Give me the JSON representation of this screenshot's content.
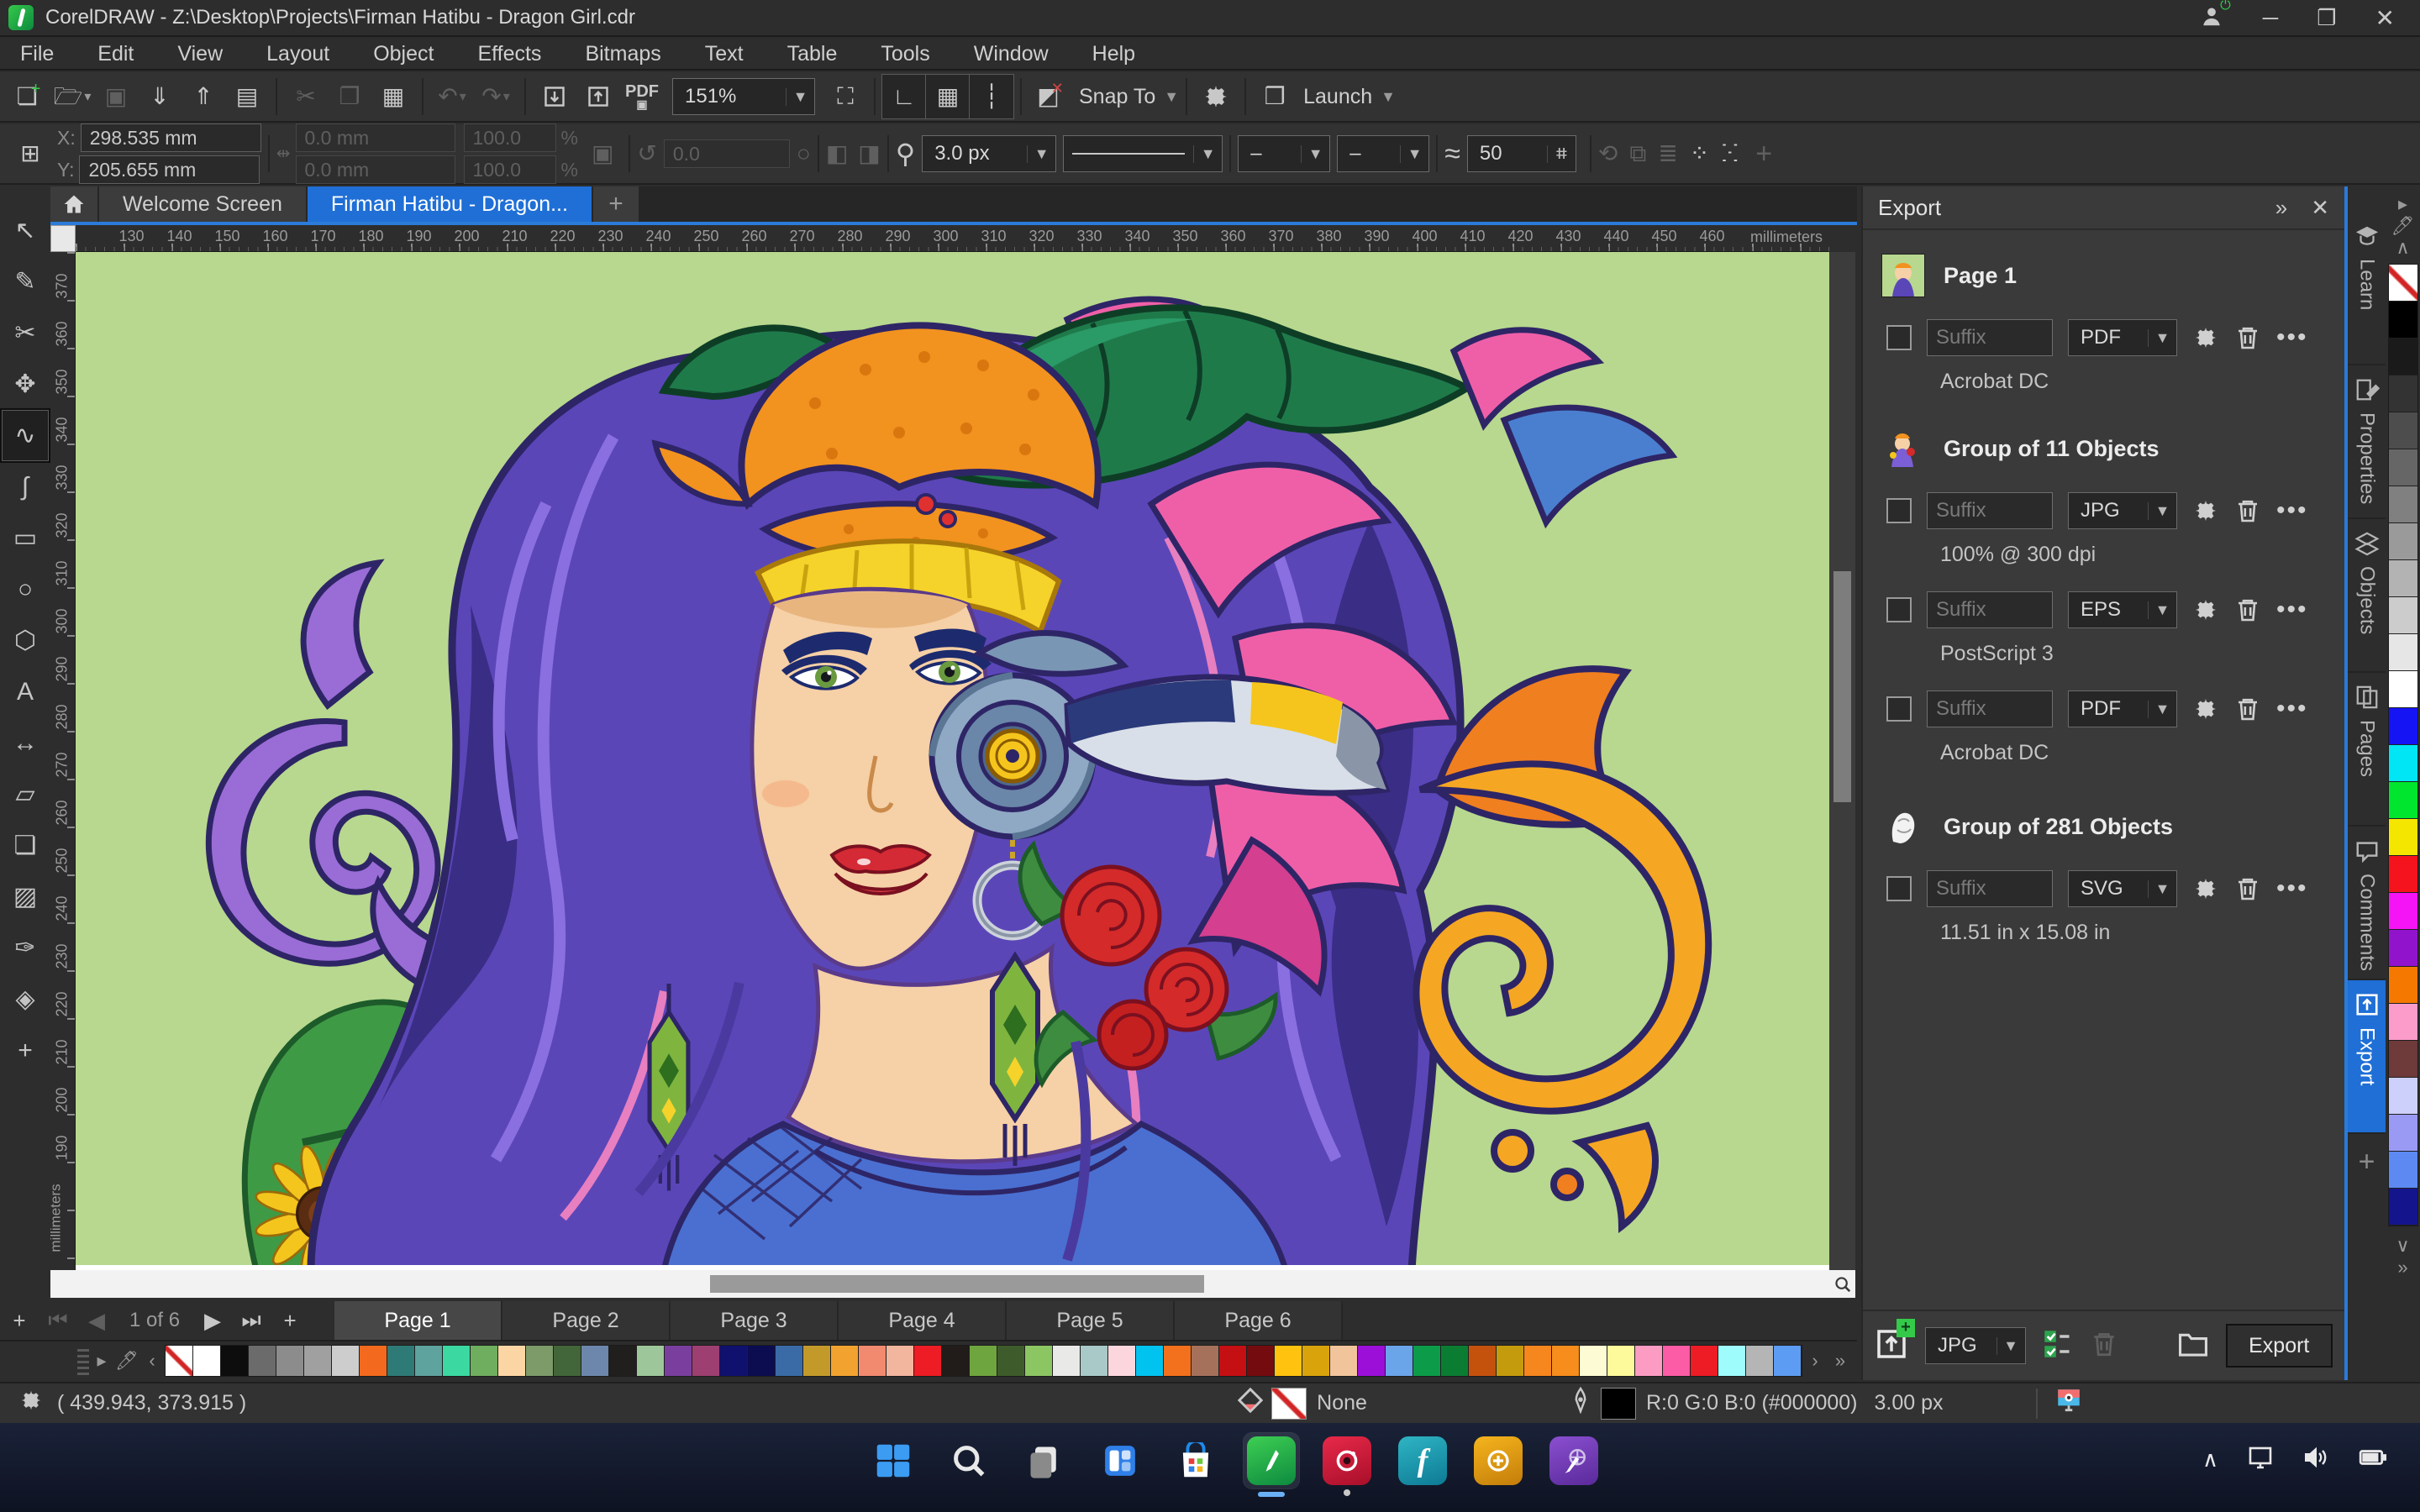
{
  "window": {
    "title": "CorelDRAW - Z:\\Desktop\\Projects\\Firman Hatibu - Dragon Girl.cdr"
  },
  "menu": {
    "items": [
      "File",
      "Edit",
      "View",
      "Layout",
      "Object",
      "Effects",
      "Bitmaps",
      "Text",
      "Table",
      "Tools",
      "Window",
      "Help"
    ]
  },
  "standard_toolbar": {
    "zoom_level": "151%",
    "pdf_label": "PDF",
    "snap_label": "Snap To",
    "launch_label": "Launch"
  },
  "property_bar": {
    "x_label": "X:",
    "x_value": "298.535 mm",
    "y_label": "Y:",
    "y_value": "205.655 mm",
    "width_value": "0.0 mm",
    "height_value": "0.0 mm",
    "scale_x": "100.0",
    "scale_y": "100.0",
    "percent": "%",
    "rotation": "0.0",
    "outline_width": "3.0 px",
    "smoothing": "50"
  },
  "doc_tabs": {
    "tabs": [
      {
        "label": "Welcome Screen",
        "active": false
      },
      {
        "label": "Firman Hatibu - Dragon...",
        "active": true
      }
    ]
  },
  "ruler": {
    "h_numbers": [
      "130",
      "140",
      "150",
      "160",
      "170",
      "180",
      "190",
      "200",
      "210",
      "220",
      "230",
      "240",
      "250",
      "260",
      "270",
      "280",
      "290",
      "300",
      "310",
      "320",
      "330",
      "340",
      "350",
      "360",
      "370",
      "380",
      "390",
      "400",
      "410",
      "420",
      "430",
      "440",
      "450",
      "460"
    ],
    "v_numbers": [
      "370",
      "360",
      "350",
      "340",
      "330",
      "320",
      "310",
      "300",
      "290",
      "280",
      "270",
      "260",
      "250",
      "240",
      "230",
      "220",
      "210",
      "200",
      "190"
    ],
    "units": "millimeters"
  },
  "toolbox": {
    "tools": [
      {
        "name": "pick-tool",
        "glyph": "↖",
        "selected": false
      },
      {
        "name": "shape-tool",
        "glyph": "✎",
        "selected": false
      },
      {
        "name": "crop-tool",
        "glyph": "✂",
        "selected": false
      },
      {
        "name": "pan-tool",
        "glyph": "✥",
        "selected": false
      },
      {
        "name": "freehand-tool",
        "glyph": "∿",
        "selected": true
      },
      {
        "name": "artistic-media-tool",
        "glyph": "∫",
        "selected": false
      },
      {
        "name": "rectangle-tool",
        "glyph": "▭",
        "selected": false
      },
      {
        "name": "ellipse-tool",
        "glyph": "○",
        "selected": false
      },
      {
        "name": "polygon-tool",
        "glyph": "⬡",
        "selected": false
      },
      {
        "name": "text-tool",
        "glyph": "A",
        "selected": false
      },
      {
        "name": "dimension-tool",
        "glyph": "↔",
        "selected": false
      },
      {
        "name": "connector-tool",
        "glyph": "▱",
        "selected": false
      },
      {
        "name": "drop-shadow-tool",
        "glyph": "❏",
        "selected": false
      },
      {
        "name": "transparency-tool",
        "glyph": "▨",
        "selected": false
      },
      {
        "name": "color-eyedropper-tool",
        "glyph": "✑",
        "selected": false
      },
      {
        "name": "interactive-fill-tool",
        "glyph": "◈",
        "selected": false
      },
      {
        "name": "add-tool-button",
        "glyph": "+",
        "selected": false
      }
    ]
  },
  "export_panel": {
    "title": "Export",
    "items": [
      {
        "title": "Page 1",
        "rows": [
          {
            "suffix_placeholder": "Suffix",
            "format": "PDF",
            "note": "Acrobat DC"
          }
        ]
      },
      {
        "title": "Group of 11 Objects",
        "rows": [
          {
            "suffix_placeholder": "Suffix",
            "format": "JPG",
            "note": "100% @ 300 dpi"
          },
          {
            "suffix_placeholder": "Suffix",
            "format": "EPS",
            "note": "PostScript 3"
          },
          {
            "suffix_placeholder": "Suffix",
            "format": "PDF",
            "note": "Acrobat DC"
          }
        ]
      },
      {
        "title": "Group of 281 Objects",
        "rows": [
          {
            "suffix_placeholder": "Suffix",
            "format": "SVG",
            "note": "11.51 in x 15.08 in"
          }
        ]
      }
    ],
    "footer": {
      "format": "JPG",
      "export_label": "Export"
    }
  },
  "dock": {
    "tabs": [
      {
        "label": "Learn",
        "active": false
      },
      {
        "label": "Properties",
        "active": false
      },
      {
        "label": "Objects",
        "active": false
      },
      {
        "label": "Pages",
        "active": false
      },
      {
        "label": "Comments",
        "active": false
      },
      {
        "label": "Export",
        "active": true
      }
    ]
  },
  "page_nav": {
    "counter": "1 of 6",
    "pages": [
      {
        "label": "Page 1",
        "active": true
      },
      {
        "label": "Page 2",
        "active": false
      },
      {
        "label": "Page 3",
        "active": false
      },
      {
        "label": "Page 4",
        "active": false
      },
      {
        "label": "Page 5",
        "active": false
      },
      {
        "label": "Page 6",
        "active": false
      }
    ]
  },
  "palette_bottom": {
    "swatches": [
      {
        "name": "none",
        "css": "linear-gradient(45deg,#fff 42%,#d22525 46%,#d22525 54%,#fff 58%)"
      },
      {
        "name": "white",
        "css": "#ffffff"
      },
      {
        "name": "black",
        "css": "#0d0d0d"
      },
      {
        "name": "gray-60",
        "css": "#6b6b6b"
      },
      {
        "name": "gray-50",
        "css": "#8c8c8c"
      },
      {
        "name": "gray-40",
        "css": "#a0a0a0"
      },
      {
        "name": "gray-20",
        "css": "#cdcdcd"
      },
      {
        "name": "orange",
        "css": "#f3691d"
      },
      {
        "name": "dark-teal",
        "css": "#2e7a76"
      },
      {
        "name": "teal",
        "css": "#5ea39e"
      },
      {
        "name": "spring-green",
        "css": "#3bd9a1"
      },
      {
        "name": "green",
        "css": "#6fae5f"
      },
      {
        "name": "peach",
        "css": "#fbd6a4"
      },
      {
        "name": "sage",
        "css": "#7d9a69"
      },
      {
        "name": "forest",
        "css": "#43653a"
      },
      {
        "name": "blue-gray",
        "css": "#6d87ac"
      },
      {
        "name": "near-black",
        "css": "#201f1d"
      },
      {
        "name": "pale-green",
        "css": "#9dc79a"
      },
      {
        "name": "purple",
        "css": "#7a3f9e"
      },
      {
        "name": "plum",
        "css": "#9d3f70"
      },
      {
        "name": "navy",
        "css": "#10106e"
      },
      {
        "name": "dark-navy",
        "css": "#0c0c50"
      },
      {
        "name": "steel-blue",
        "css": "#3a6ba6"
      },
      {
        "name": "gold",
        "css": "#c39a2a"
      },
      {
        "name": "amber",
        "css": "#f2a32f"
      },
      {
        "name": "salmon",
        "css": "#f28a6f"
      },
      {
        "name": "light-salmon",
        "css": "#f2b59e"
      },
      {
        "name": "red",
        "css": "#ee1c24"
      },
      {
        "name": "charcoal",
        "css": "#211c19"
      },
      {
        "name": "grass",
        "css": "#6fa53e"
      },
      {
        "name": "dark-olive",
        "css": "#3e5c2b"
      },
      {
        "name": "light-green",
        "css": "#8cc662"
      },
      {
        "name": "off-white",
        "css": "#e9e9e7"
      },
      {
        "name": "pale-blue",
        "css": "#a8c9c7"
      },
      {
        "name": "pale-pink",
        "css": "#fbd7dd"
      },
      {
        "name": "cyan",
        "css": "#00c3f0"
      },
      {
        "name": "orange-2",
        "css": "#f3701c"
      },
      {
        "name": "brown",
        "css": "#a5715b"
      },
      {
        "name": "crimson",
        "css": "#c40f13"
      },
      {
        "name": "maroon",
        "css": "#740b0e"
      },
      {
        "name": "yellow",
        "css": "#ffc20e"
      },
      {
        "name": "dark-yellow",
        "css": "#d9a40b"
      },
      {
        "name": "tan",
        "css": "#f2c49b"
      },
      {
        "name": "violet",
        "css": "#9b0fd9"
      },
      {
        "name": "cornflower",
        "css": "#6aa4e9"
      },
      {
        "name": "green-2",
        "css": "#0c9c49"
      },
      {
        "name": "dark-green",
        "css": "#0b7d33"
      },
      {
        "name": "rust",
        "css": "#c4520d"
      },
      {
        "name": "dark-gold",
        "css": "#c49b0d"
      },
      {
        "name": "orange-3",
        "css": "#f6861e"
      },
      {
        "name": "orange-4",
        "css": "#f78d1c"
      },
      {
        "name": "cream",
        "css": "#fdfbd3"
      },
      {
        "name": "light-yellow",
        "css": "#fdfa9b"
      },
      {
        "name": "pink",
        "css": "#fc9cc3"
      },
      {
        "name": "hot-pink",
        "css": "#fc5ca5"
      },
      {
        "name": "red-2",
        "css": "#ee1c25"
      },
      {
        "name": "ice-blue",
        "css": "#9ffcfc"
      },
      {
        "name": "silver",
        "css": "#b5b5b5"
      },
      {
        "name": "sky-blue",
        "css": "#5c9cf2"
      }
    ]
  },
  "palette_right": {
    "swatches": [
      {
        "name": "none",
        "css": "linear-gradient(45deg,#fff 42%,#d22525 46%,#d22525 54%,#fff 58%)"
      },
      {
        "name": "black",
        "css": "#000000"
      },
      {
        "name": "black-90",
        "css": "#1a1a1a"
      },
      {
        "name": "black-80",
        "css": "#333333"
      },
      {
        "name": "black-70",
        "css": "#4d4d4d"
      },
      {
        "name": "black-60",
        "css": "#666666"
      },
      {
        "name": "black-50",
        "css": "#808080"
      },
      {
        "name": "black-40",
        "css": "#9a9a9a"
      },
      {
        "name": "black-30",
        "css": "#b3b3b3"
      },
      {
        "name": "black-20",
        "css": "#cccccc"
      },
      {
        "name": "black-10",
        "css": "#e6e6e6"
      },
      {
        "name": "white",
        "css": "#ffffff"
      },
      {
        "name": "blue",
        "css": "#1414f5"
      },
      {
        "name": "cyan",
        "css": "#00e6f5"
      },
      {
        "name": "green",
        "css": "#00e62e"
      },
      {
        "name": "yellow",
        "css": "#f5e600"
      },
      {
        "name": "red",
        "css": "#f5141e"
      },
      {
        "name": "magenta",
        "css": "#f514f5"
      },
      {
        "name": "purple",
        "css": "#9114cc"
      },
      {
        "name": "orange",
        "css": "#f57900"
      },
      {
        "name": "pink",
        "css": "#fc9ccb"
      },
      {
        "name": "brown",
        "css": "#6e3a3a"
      },
      {
        "name": "lavender",
        "css": "#ccd0fa"
      },
      {
        "name": "periwinkle",
        "css": "#9a9af5"
      },
      {
        "name": "cornflower",
        "css": "#5c8af2"
      },
      {
        "name": "navy",
        "css": "#14148c"
      }
    ]
  },
  "status_bar": {
    "coords": "( 439.943, 373.915 )",
    "fill_label": "None",
    "outline_color_text": "R:0 G:0 B:0 (#000000)",
    "outline_width_text": "3.00 px"
  },
  "page_counter_nav": {
    "add": "+",
    "first": "first-page",
    "prev": "previous-page",
    "next": "next-page",
    "last": "last-page"
  },
  "taskbar": {
    "icons": [
      "start",
      "search",
      "task-view",
      "widgets",
      "store",
      "coreldraw",
      "photo-paint",
      "font-manager",
      "connect",
      "web-app"
    ],
    "tray": [
      "hidden-icons",
      "display",
      "volume",
      "battery"
    ]
  },
  "colors": {
    "accent": "#1f6fd6",
    "canvas_green": "#b7d88e",
    "taskbar_navy": "#141b2e"
  }
}
